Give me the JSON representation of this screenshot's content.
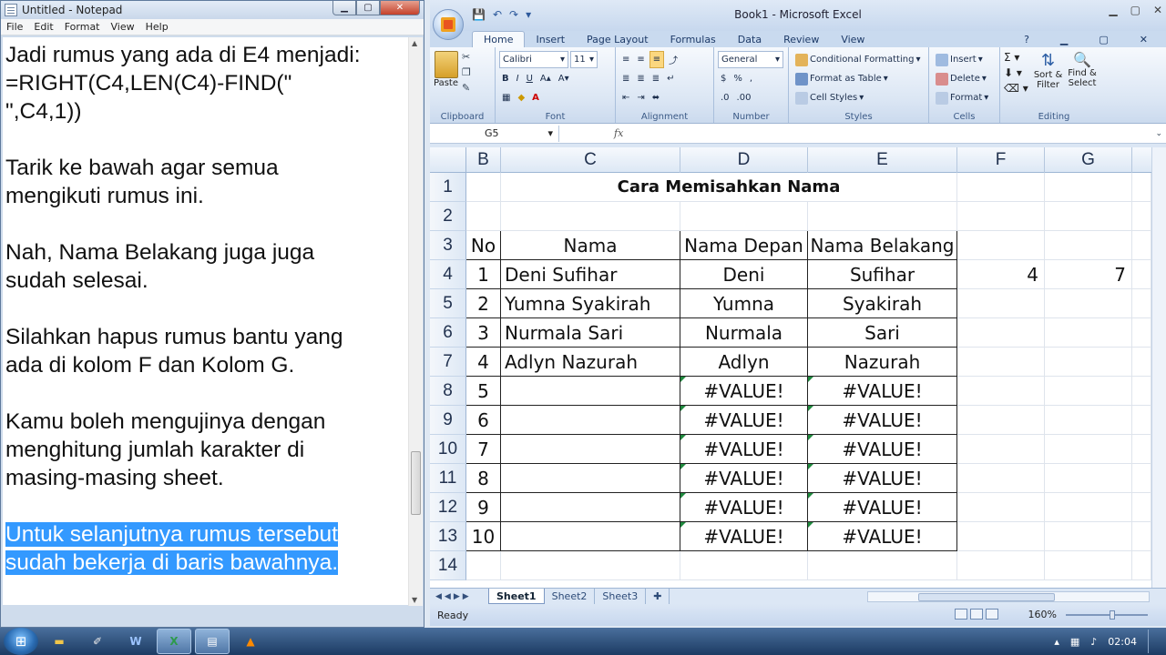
{
  "notepad": {
    "title": "Untitled - Notepad",
    "menu": [
      "File",
      "Edit",
      "Format",
      "View",
      "Help"
    ],
    "lines": [
      {
        "text": "Jadi rumus yang ada di E4 menjadi:",
        "hl": false
      },
      {
        "text": "=RIGHT(C4,LEN(C4)-FIND(\"",
        "hl": false
      },
      {
        "text": "\",C4,1))",
        "hl": false
      },
      {
        "text": "",
        "hl": false
      },
      {
        "text": "Tarik ke bawah agar semua",
        "hl": false
      },
      {
        "text": "mengikuti rumus ini.",
        "hl": false
      },
      {
        "text": "",
        "hl": false
      },
      {
        "text": "Nah, Nama Belakang juga juga",
        "hl": false
      },
      {
        "text": "sudah selesai.",
        "hl": false
      },
      {
        "text": "",
        "hl": false
      },
      {
        "text": "Silahkan hapus rumus bantu yang",
        "hl": false
      },
      {
        "text": "ada di kolom F dan Kolom G.",
        "hl": false
      },
      {
        "text": "",
        "hl": false
      },
      {
        "text": "Kamu boleh mengujinya dengan",
        "hl": false
      },
      {
        "text": "menghitung jumlah karakter di",
        "hl": false
      },
      {
        "text": "masing-masing sheet.",
        "hl": false
      },
      {
        "text": "",
        "hl": false
      },
      {
        "text": "Untuk selanjutnya rumus tersebut",
        "hl": true
      },
      {
        "text": "sudah bekerja di baris bawahnya.",
        "hl": true
      }
    ]
  },
  "excel": {
    "title": "Book1 - Microsoft Excel",
    "tabs": [
      "Home",
      "Insert",
      "Page Layout",
      "Formulas",
      "Data",
      "Review",
      "View"
    ],
    "active_tab": "Home",
    "ribbon": {
      "clipboard": {
        "label": "Clipboard",
        "paste": "Paste"
      },
      "font": {
        "label": "Font",
        "name": "Calibri",
        "size": "11"
      },
      "alignment": {
        "label": "Alignment"
      },
      "number": {
        "label": "Number",
        "format": "General"
      },
      "styles": {
        "label": "Styles",
        "cond": "Conditional Formatting",
        "table": "Format as Table",
        "cell": "Cell Styles"
      },
      "cells": {
        "label": "Cells",
        "insert": "Insert",
        "delete": "Delete",
        "format": "Format"
      },
      "editing": {
        "label": "Editing",
        "sort": "Sort &",
        "sort2": "Filter",
        "find": "Find &",
        "find2": "Select"
      }
    },
    "name_box": "G5",
    "col_headers": [
      "B",
      "C",
      "D",
      "E",
      "F",
      "G"
    ],
    "title_cell": "Cara Memisahkan Nama",
    "row_numbers": [
      "1",
      "2",
      "3",
      "4",
      "5",
      "6",
      "7",
      "8",
      "9",
      "10",
      "11",
      "12",
      "13",
      "14"
    ],
    "headers": [
      "No",
      "Nama",
      "Nama Depan",
      "Nama Belakang"
    ],
    "rows": [
      {
        "no": "1",
        "nama": "Deni Sufihar",
        "depan": "Deni",
        "belakang": "Sufihar",
        "f": "4",
        "g": "7"
      },
      {
        "no": "2",
        "nama": "Yumna Syakirah",
        "depan": "Yumna",
        "belakang": "Syakirah",
        "f": "",
        "g": ""
      },
      {
        "no": "3",
        "nama": "Nurmala Sari",
        "depan": "Nurmala",
        "belakang": "Sari",
        "f": "",
        "g": ""
      },
      {
        "no": "4",
        "nama": "Adlyn Nazurah",
        "depan": "Adlyn",
        "belakang": "Nazurah",
        "f": "",
        "g": ""
      },
      {
        "no": "5",
        "nama": "",
        "depan": "#VALUE!",
        "belakang": "#VALUE!",
        "f": "",
        "g": ""
      },
      {
        "no": "6",
        "nama": "",
        "depan": "#VALUE!",
        "belakang": "#VALUE!",
        "f": "",
        "g": ""
      },
      {
        "no": "7",
        "nama": "",
        "depan": "#VALUE!",
        "belakang": "#VALUE!",
        "f": "",
        "g": ""
      },
      {
        "no": "8",
        "nama": "",
        "depan": "#VALUE!",
        "belakang": "#VALUE!",
        "f": "",
        "g": ""
      },
      {
        "no": "9",
        "nama": "",
        "depan": "#VALUE!",
        "belakang": "#VALUE!",
        "f": "",
        "g": ""
      },
      {
        "no": "10",
        "nama": "",
        "depan": "#VALUE!",
        "belakang": "#VALUE!",
        "f": "",
        "g": ""
      }
    ],
    "sheets": [
      "Sheet1",
      "Sheet2",
      "Sheet3"
    ],
    "active_sheet": "Sheet1",
    "status": "Ready",
    "zoom": "160%"
  },
  "taskbar": {
    "time": "02:04"
  }
}
